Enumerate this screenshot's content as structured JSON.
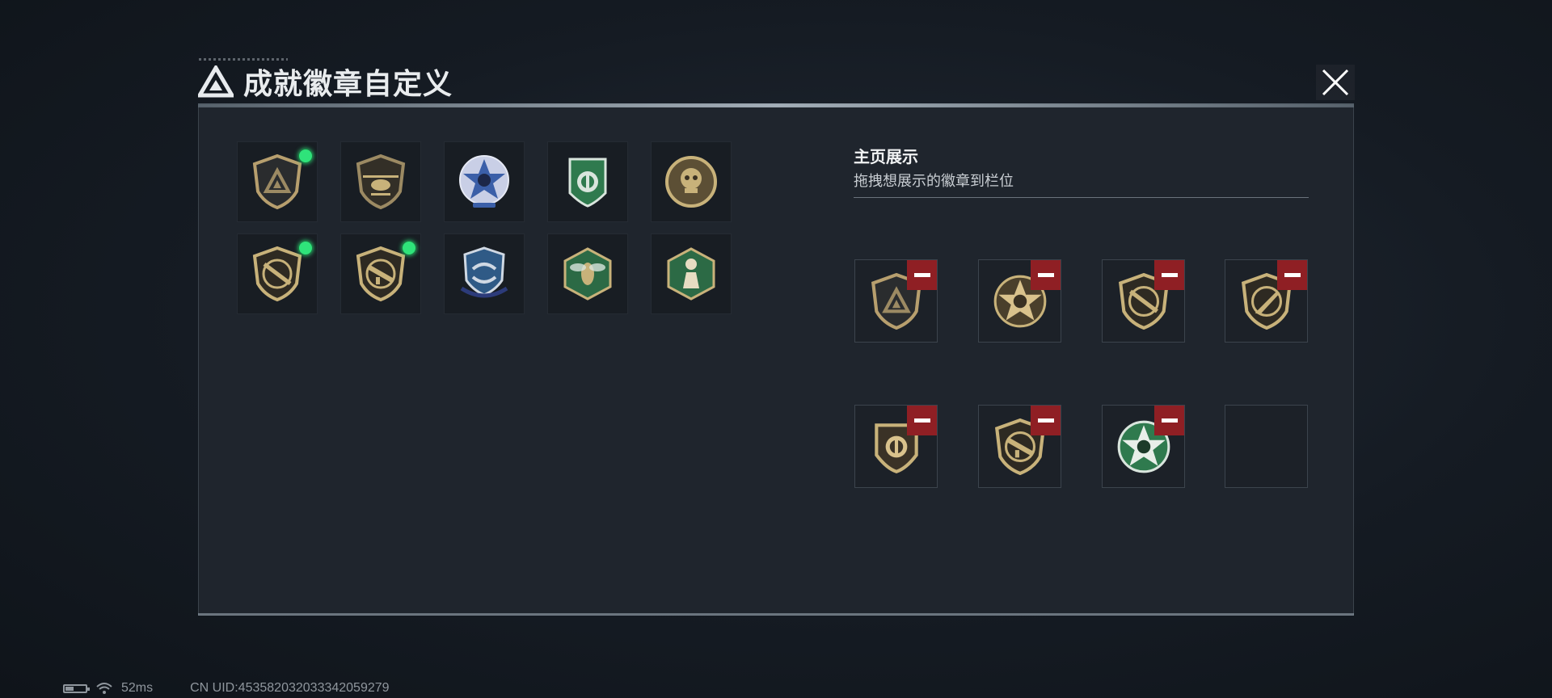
{
  "header": {
    "title": "成就徽章自定义",
    "logo_icon": "triangle-logo-icon",
    "close_icon": "close-icon"
  },
  "badge_grid": [
    {
      "icon": "triangle-shield-badge-icon",
      "equipped": true
    },
    {
      "icon": "helicopter-shield-badge-icon",
      "equipped": false
    },
    {
      "icon": "blue-skull-star-badge-icon",
      "equipped": false
    },
    {
      "icon": "green-shield-badge-icon",
      "equipped": false
    },
    {
      "icon": "gold-round-skull-badge-icon",
      "equipped": false
    },
    {
      "icon": "rifle-shield-badge-icon",
      "equipped": true
    },
    {
      "icon": "smg-shield-badge-icon",
      "equipped": true
    },
    {
      "icon": "blue-arrows-shield-badge-icon",
      "equipped": false
    },
    {
      "icon": "green-hex-wasp-badge-icon",
      "equipped": false
    },
    {
      "icon": "green-hex-figure-badge-icon",
      "equipped": false
    }
  ],
  "showcase": {
    "heading": "主页展示",
    "subtitle": "拖拽想展示的徽章到栏位",
    "slots": [
      {
        "icon": "triangle-shield-badge-icon",
        "filled": true
      },
      {
        "icon": "gold-skull-star-badge-icon",
        "filled": true
      },
      {
        "icon": "rifle-shield-badge-icon",
        "filled": true
      },
      {
        "icon": "knife-shield-badge-icon",
        "filled": true
      },
      {
        "icon": "round-shield-badge-icon",
        "filled": true
      },
      {
        "icon": "smg-shield-badge-icon",
        "filled": true
      },
      {
        "icon": "green-skull-star-badge-icon",
        "filled": true
      },
      {
        "icon": "",
        "filled": false
      }
    ]
  },
  "status_bar": {
    "ping": "52ms",
    "uid": "CN UID:453582032033342059279"
  },
  "colors": {
    "panel_bg": "#1f252d",
    "equipped_dot": "#2fe37a",
    "remove_button": "#8f1f24",
    "badge_gold": "#c8b27a",
    "badge_green": "#3f8a5a",
    "badge_blue": "#3b5fa8"
  }
}
